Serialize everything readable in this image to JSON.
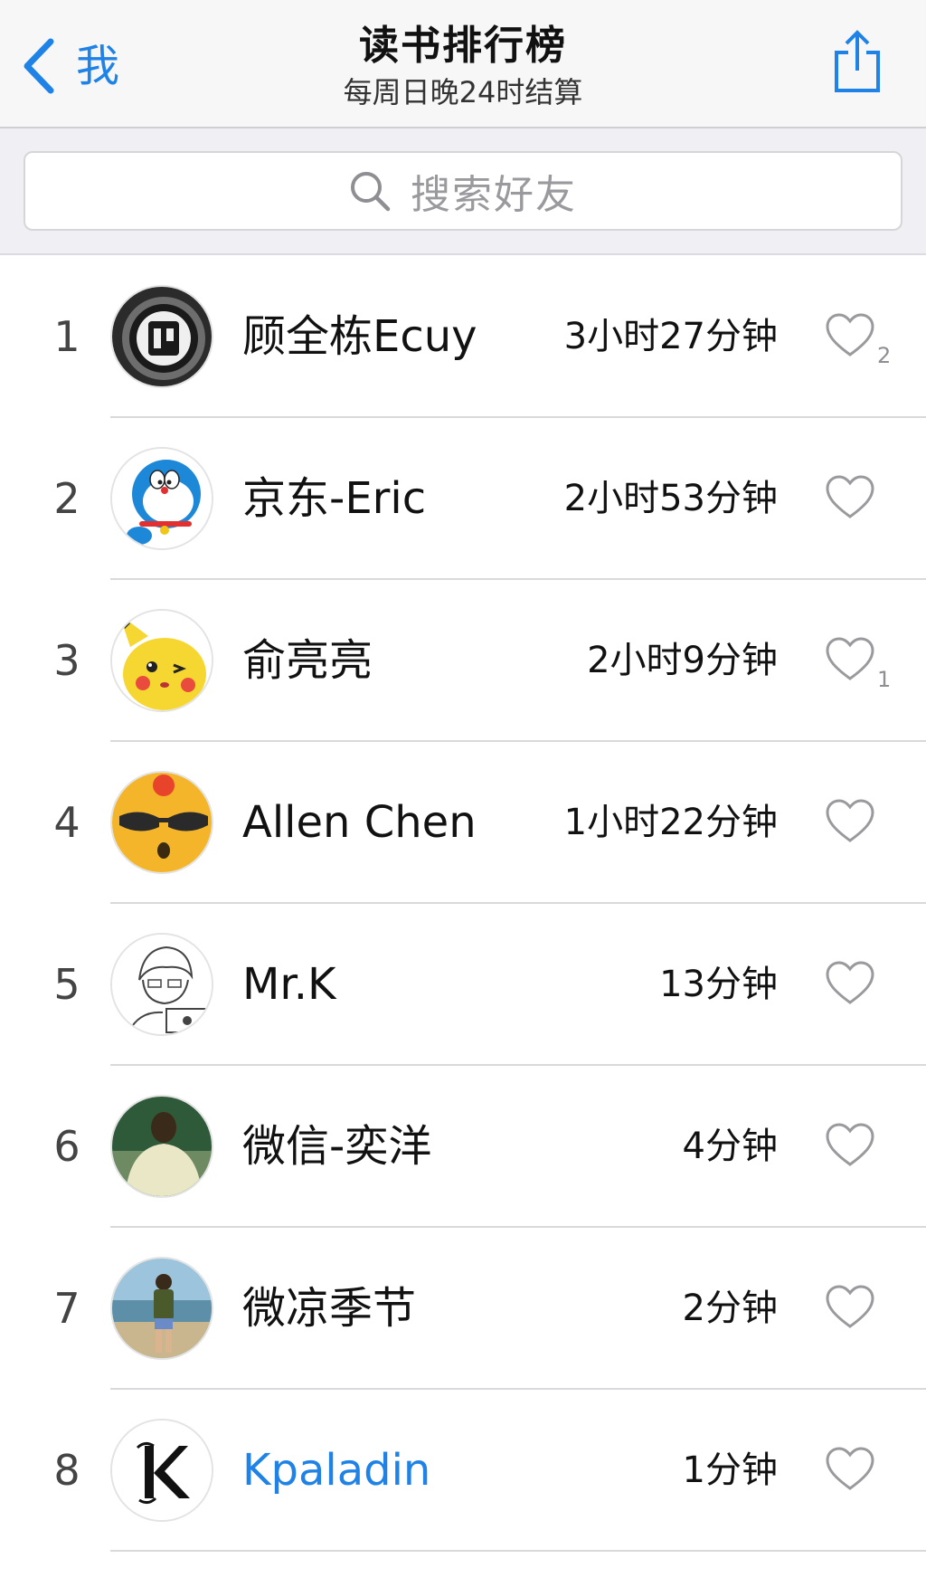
{
  "nav": {
    "back_label": "我",
    "title": "读书排行榜",
    "subtitle": "每周日晚24时结算"
  },
  "search": {
    "placeholder": "搜索好友"
  },
  "colors": {
    "accent": "#1e82e6",
    "nav_bg": "#f7f7f7",
    "search_band_bg": "#efeff4"
  },
  "rows": [
    {
      "rank": "1",
      "name": "顾全栋Ecuy",
      "duration": "3小时27分钟",
      "likes": "2",
      "avatar_icon": "dark-emblem-avatar"
    },
    {
      "rank": "2",
      "name": "京东-Eric",
      "duration": "2小时53分钟",
      "likes": "",
      "avatar_icon": "doraemon-avatar"
    },
    {
      "rank": "3",
      "name": "俞亮亮",
      "duration": "2小时9分钟",
      "likes": "1",
      "avatar_icon": "pikachu-avatar"
    },
    {
      "rank": "4",
      "name": "Allen Chen",
      "duration": "1小时22分钟",
      "likes": "",
      "avatar_icon": "sunglasses-face-avatar"
    },
    {
      "rank": "5",
      "name": "Mr.K",
      "duration": "13分钟",
      "likes": "",
      "avatar_icon": "sketch-character-avatar"
    },
    {
      "rank": "6",
      "name": "微信-奕洋",
      "duration": "4分钟",
      "likes": "",
      "avatar_icon": "person-back-avatar"
    },
    {
      "rank": "7",
      "name": "微凉季节",
      "duration": "2分钟",
      "likes": "",
      "avatar_icon": "beach-photo-avatar"
    },
    {
      "rank": "8",
      "name": "Kpaladin",
      "duration": "1分钟",
      "likes": "",
      "avatar_icon": "letter-k-avatar"
    }
  ]
}
